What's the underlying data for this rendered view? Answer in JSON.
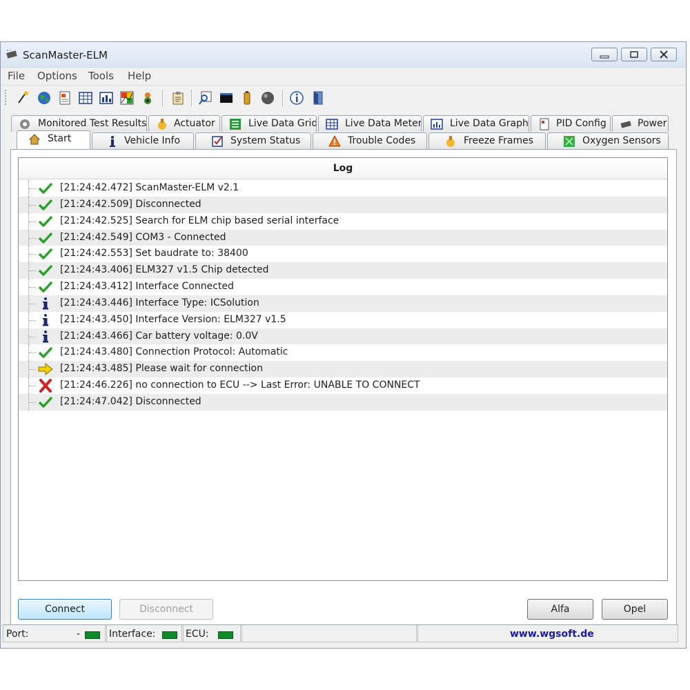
{
  "window": {
    "title": "ScanMaster-ELM"
  },
  "menu": [
    "File",
    "Options",
    "Tools",
    "Help"
  ],
  "toolbar": {
    "icons": [
      "wizard-icon",
      "globe-icon",
      "document-icon",
      "grid-icon",
      "meter-icon",
      "graph-icon",
      "engine-icon",
      "clipboard-icon",
      "find-icon",
      "terminal-icon",
      "battery-icon",
      "ball-icon",
      "info-icon",
      "exit-icon"
    ]
  },
  "tabs": {
    "row1": [
      "Monitored Test Results",
      "Actuator",
      "Live Data Grid",
      "Live Data Meter",
      "Live Data Graph",
      "PID Config",
      "Power"
    ],
    "row2": [
      "Start",
      "Vehicle Info",
      "System Status",
      "Trouble Codes",
      "Freeze Frames",
      "Oxygen Sensors"
    ],
    "active": "Start"
  },
  "log": {
    "header": "Log",
    "entries": [
      {
        "icon": "check",
        "text": "[21:24:42.472] ScanMaster-ELM v2.1"
      },
      {
        "icon": "check",
        "text": "[21:24:42.509] Disconnected"
      },
      {
        "icon": "check",
        "text": "[21:24:42.525] Search for ELM chip based serial interface"
      },
      {
        "icon": "check",
        "text": "[21:24:42.549] COM3 - Connected"
      },
      {
        "icon": "check",
        "text": "[21:24:42.553] Set baudrate to: 38400"
      },
      {
        "icon": "check",
        "text": "[21:24:43.406] ELM327 v1.5 Chip detected"
      },
      {
        "icon": "check",
        "text": "[21:24:43.412] Interface Connected"
      },
      {
        "icon": "info",
        "text": "[21:24:43.446] Interface Type: ICSolution"
      },
      {
        "icon": "info",
        "text": "[21:24:43.450] Interface Version: ELM327 v1.5"
      },
      {
        "icon": "info",
        "text": "[21:24:43.466] Car battery voltage: 0.0V"
      },
      {
        "icon": "check",
        "text": "[21:24:43.480] Connection Protocol: Automatic"
      },
      {
        "icon": "arrow",
        "text": "[21:24:43.485] Please wait for connection"
      },
      {
        "icon": "error",
        "text": "[21:24:46.226] no connection to ECU --> Last Error: UNABLE TO CONNECT"
      },
      {
        "icon": "check",
        "text": "[21:24:47.042] Disconnected"
      }
    ]
  },
  "buttons": {
    "connect": "Connect",
    "disconnect": "Disconnect",
    "alfa": "Alfa",
    "opel": "Opel"
  },
  "status": {
    "port_label": "Port:",
    "port_value": "-",
    "interface_label": "Interface:",
    "ecu_label": "ECU:",
    "website": "www.wgsoft.de"
  },
  "colors": {
    "led": "#0f8a2a",
    "check": "#2aa02a",
    "error": "#d02020",
    "arrow": "#f2d000",
    "info": "#1a2a6c",
    "link": "#1a1aa6"
  }
}
